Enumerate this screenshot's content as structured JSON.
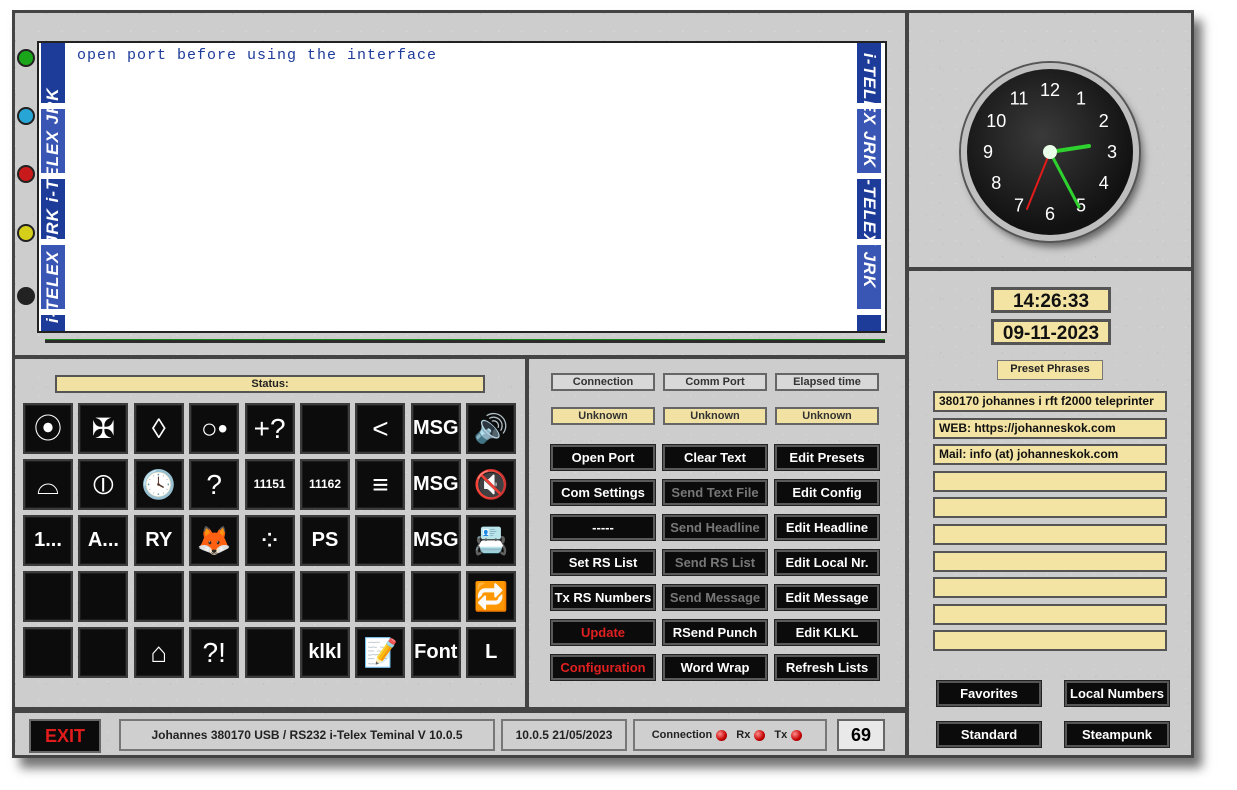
{
  "terminal": {
    "line": "open port before using the interface",
    "brand": "i-TELEX JRK i-TELEX JRK"
  },
  "clock": {
    "hours": [
      "12",
      "1",
      "2",
      "3",
      "4",
      "5",
      "6",
      "7",
      "8",
      "9",
      "10",
      "11"
    ],
    "time_shown": "14:26:33"
  },
  "datetime": {
    "time": "14:26:33",
    "date": "09-11-2023"
  },
  "presets": {
    "title": "Preset Phrases",
    "phrases": [
      "380170 johannes i rft f2000 teleprinter",
      "WEB: https://johanneskok.com",
      "Mail: info (at) johanneskok.com",
      "",
      "",
      "",
      "",
      "",
      "",
      ""
    ]
  },
  "right_buttons": {
    "favorites": "Favorites",
    "local_numbers": "Local Numbers",
    "standard": "Standard",
    "steampunk": "Steampunk"
  },
  "function_panel": {
    "status_label": "Status:",
    "keys": [
      [
        "⦿",
        "✠",
        "◊",
        "○•",
        "+?",
        "",
        "<",
        "MSG",
        "🔊"
      ],
      [
        "⌓",
        "⦶",
        "🕓",
        "?",
        "11151",
        "11162",
        "≡",
        "MSG",
        "🔇"
      ],
      [
        "1...",
        "A...",
        "RY",
        "🦊",
        "⁘",
        "PS",
        "",
        "MSG",
        "📇"
      ],
      [
        "",
        "",
        "",
        "",
        "",
        "",
        "",
        "",
        "🔁"
      ],
      [
        "",
        "",
        "⌂",
        "?!",
        "",
        "klkl",
        "📝",
        "Font",
        "L"
      ]
    ]
  },
  "control_panel": {
    "headers": [
      "Connection",
      "Comm Port",
      "Elapsed time"
    ],
    "values": [
      "Unknown",
      "Unknown",
      "Unknown"
    ],
    "buttons": [
      [
        "Open Port",
        "Clear Text",
        "Edit Presets"
      ],
      [
        "Com Settings",
        "Send Text File",
        "Edit Config"
      ],
      [
        "-----",
        "Send Headline",
        "Edit Headline"
      ],
      [
        "Set RS List",
        "Send RS List",
        "Edit Local Nr."
      ],
      [
        "Tx RS Numbers",
        "Send Message",
        "Edit Message"
      ],
      [
        "Update",
        "RSend Punch",
        "Edit KLKL"
      ],
      [
        "Configuration",
        "Word Wrap",
        "Refresh Lists"
      ]
    ]
  },
  "footer": {
    "exit": "EXIT",
    "title": "Johannes 380170 USB / RS232 i-Telex Teminal V 10.0.5",
    "version": "10.0.5  21/05/2023",
    "connection": "Connection",
    "rx": "Rx",
    "tx": "Tx",
    "counter": "69"
  },
  "colors": {
    "accent_yellow": "#f3e4a4",
    "led_red": "#c40000",
    "hand_green": "#2ed12e",
    "second_red": "#e21b1b",
    "paper_text": "#1d3b9a"
  }
}
